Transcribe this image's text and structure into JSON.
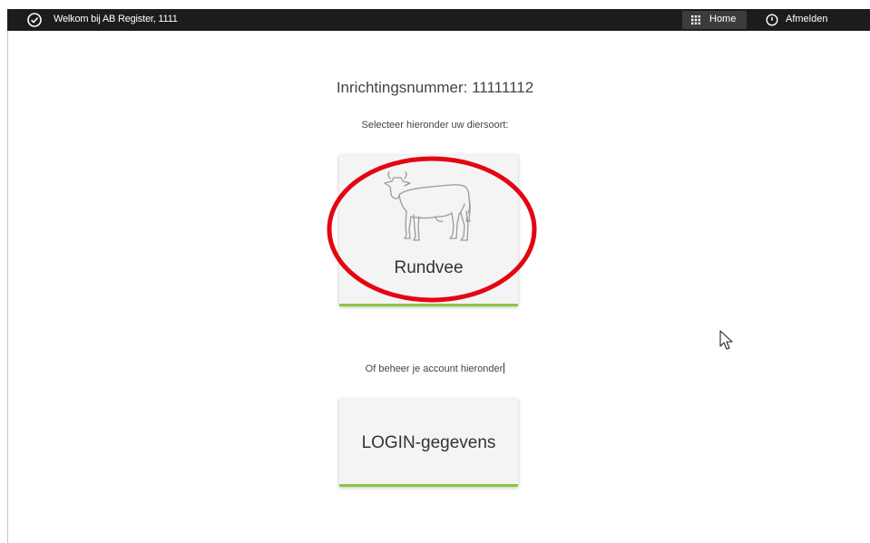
{
  "header": {
    "welcome_text": "Welkom bij AB Register, 1111",
    "home_label": "Home",
    "logout_label": "Afmelden"
  },
  "main": {
    "heading": "Inrichtingsnummer: 11111112",
    "select_prompt": "Selecteer hieronder uw diersoort:",
    "species_card_label": "Rundvee",
    "account_prompt": "Of beheer je account hieronder",
    "login_card_label": "LOGIN-gegevens"
  },
  "icons": {
    "header_left": "check-circle-icon",
    "home": "grid-icon",
    "logout": "power-icon",
    "species": "cow-icon",
    "pointer": "mouse-cursor-icon"
  },
  "colors": {
    "topbar": "#1c1c1c",
    "home_button": "#3c3c3c",
    "card_background": "#f4f4f4",
    "card_accent": "#8cc63f",
    "highlight": "#e30613"
  }
}
